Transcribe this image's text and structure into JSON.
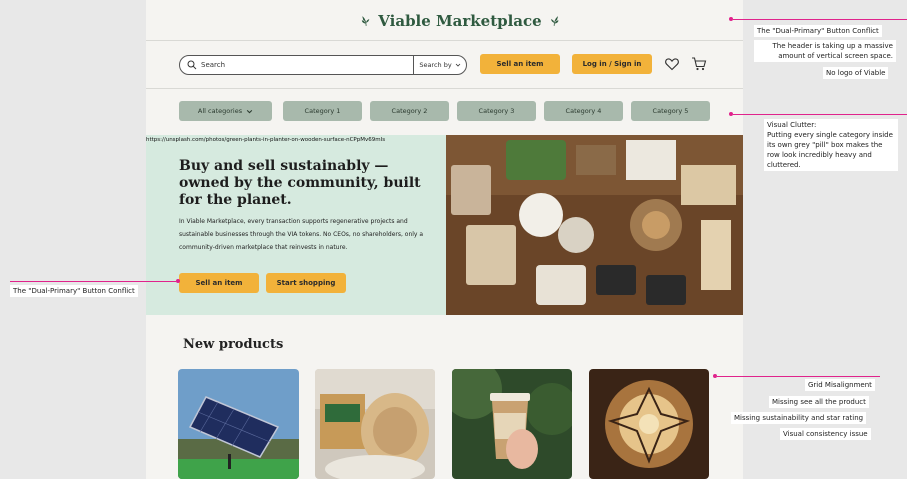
{
  "header": {
    "brand_title": "Viable Marketplace",
    "search_placeholder": "Search",
    "search_by_label": "Search by",
    "sell_label": "Sell an item",
    "login_label": "Log in / Sign in",
    "wishlist_icon": "heart-icon",
    "cart_icon": "cart-icon"
  },
  "categories": [
    "All categories",
    "Category 1",
    "Category 2",
    "Category 3",
    "Category 4",
    "Category 5"
  ],
  "hero": {
    "image_url_text": "https://unsplash.com/photos/green-plants-in-planter-on-wooden-surface-nCPpMv69mIs",
    "title": "Buy and sell sustainably — owned by the community, built for the planet.",
    "body": "In Viable Marketplace, every transaction supports regenerative projects and sustainable businesses through the VIA tokens. No CEOs, no shareholders, only a community-driven marketplace that reinvests in nature.",
    "sell_label": "Sell an item",
    "shop_label": "Start shopping"
  },
  "products": {
    "section_title": "New products"
  },
  "annotations": {
    "top_right": [
      "The \"Dual-Primary\" Button Conflict",
      "The header is taking up a massive amount of vertical screen space.",
      "No logo of Viable"
    ],
    "clutter": "Visual Clutter:\nPutting every single category inside its own grey \"pill\" box makes the row look incredibly heavy and cluttered.",
    "left": "The \"Dual-Primary\" Button Conflict",
    "bottom_right": [
      "Grid Misalignment",
      "Missing see all the product",
      "Missing sustainability and star rating",
      "Visual consistency issue"
    ]
  },
  "colors": {
    "accent": "#f2b23a",
    "brand": "#2f5a40",
    "annotation": "#e0238c",
    "pill": "#a8b9ac",
    "hero_bg": "#d6eadf"
  }
}
